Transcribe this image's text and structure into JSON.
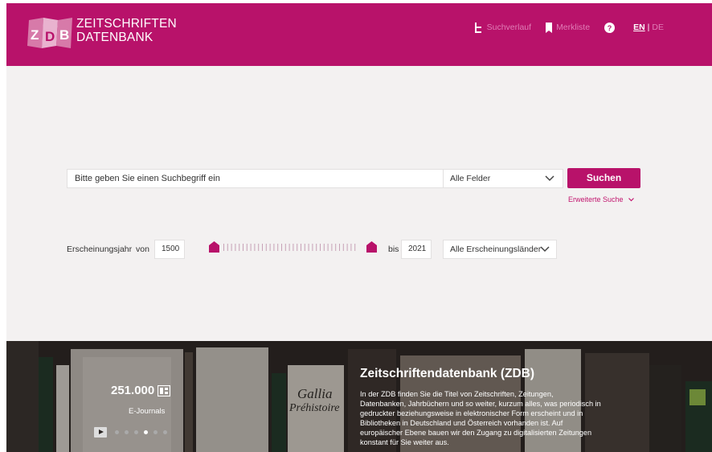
{
  "header": {
    "logo_line1": "ZEITSCHRIFTEN",
    "logo_line2": "DATENBANK",
    "nav": {
      "history_label": "Suchverlauf",
      "bookmarks_label": "Merkliste",
      "help_icon": "question-circle-icon",
      "lang_en": "EN",
      "lang_sep": "|",
      "lang_de": "DE"
    }
  },
  "search": {
    "placeholder": "Bitte geben Sie einen Suchbegriff ein",
    "field_selected": "Alle Felder",
    "button_label": "Suchen",
    "advanced_label": "Erweiterte Suche"
  },
  "filter": {
    "year_label": "Erscheinungsjahr",
    "von_label": "von",
    "year_from": "1500",
    "bis_label": "bis",
    "year_to": "2021",
    "country_selected": "Alle Erscheinungsländer"
  },
  "banner": {
    "stat_number": "251.000",
    "stat_label": "E-Journals",
    "carousel_dots": 6,
    "carousel_active_index": 3,
    "book_title_1": "Gallia",
    "book_title_2": "Préhistoire",
    "info_title": "Zeitschriftendatenbank (ZDB)",
    "info_text": "In der ZDB finden Sie die Titel von Zeitschriften, Zeitungen, Datenbanken, Jahrbüchern und so weiter, kurzum alles, was periodisch in gedruckter beziehungsweise in elektronischer Form erscheint und in Bibliotheken in Deutschland und Österreich vorhanden ist. Auf europäischer Ebene bauen wir den Zugang zu digitalisierten Zeitungen konstant für Sie weiter aus."
  },
  "colors": {
    "brand": "#b8126a",
    "background": "#f3f1f1",
    "banner": "#2a2523"
  }
}
